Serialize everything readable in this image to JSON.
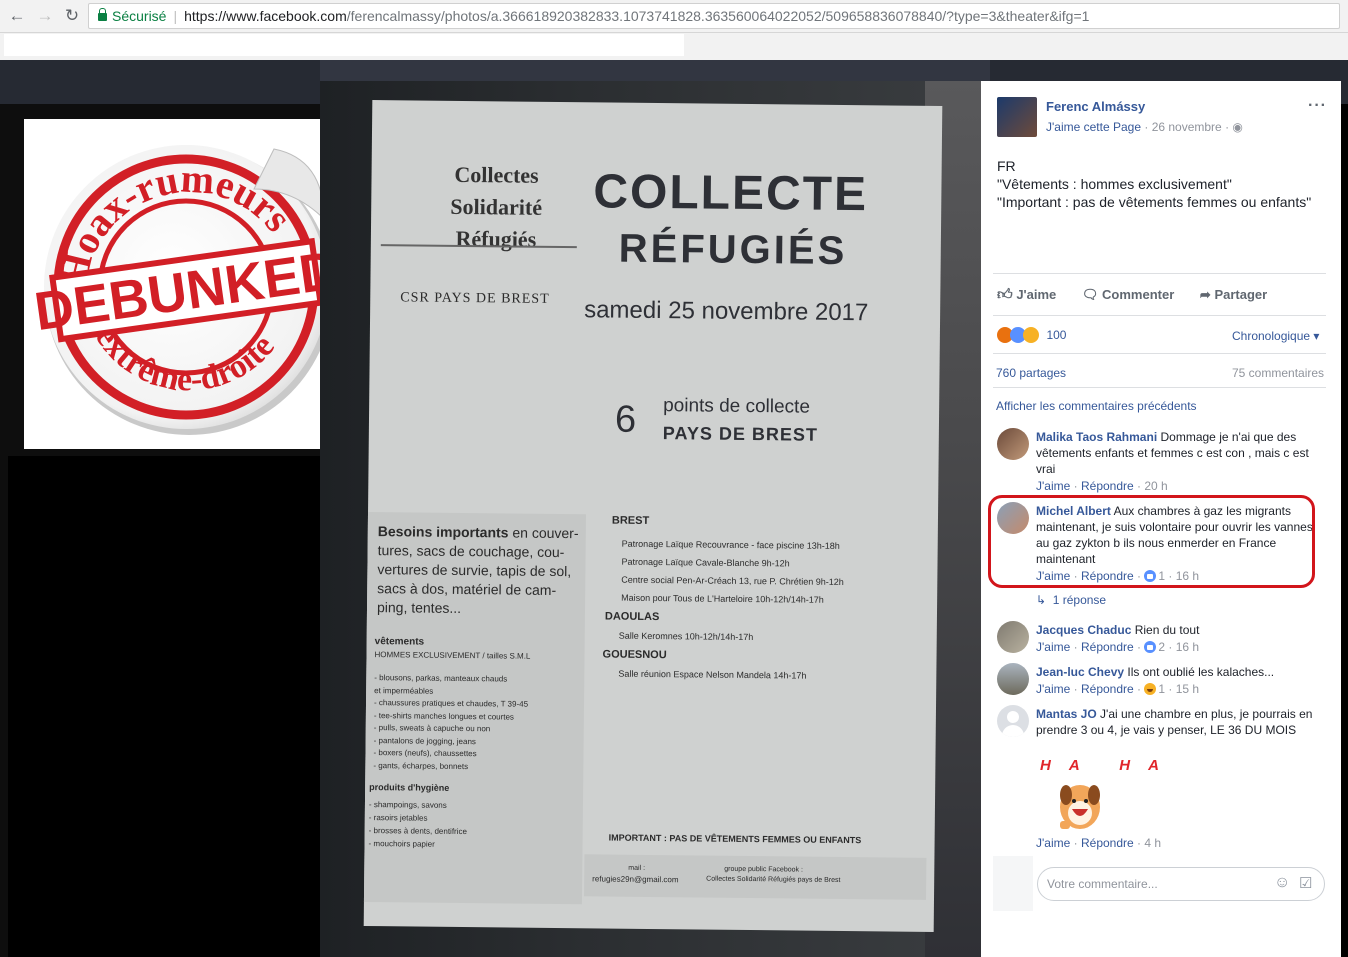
{
  "browser": {
    "secure_label": "Sécurisé",
    "url_host": "https://www.facebook.com",
    "url_path": "/ferencalmassy/photos/a.366618920382833.1073741828.363560064022052/509658836078840/?type=3&theater&ifg=1"
  },
  "stamp": {
    "top_text": "Hoax-rumeurs",
    "center_text": "DEBUNKED",
    "bottom_text": "d'extrême-droite"
  },
  "poster": {
    "org_line1": "Collectes",
    "org_line2": "Solidarité",
    "org_line3": "Réfugiés",
    "org_sub": "CSR PAYS DE BREST",
    "title1": "COLLECTE",
    "title2": "RÉFUGIÉS",
    "date": "samedi 25 novembre 2017",
    "points_number": "6",
    "points_line1": "points de collecte",
    "points_line2": "PAYS DE BREST",
    "needs_bold": "Besoins importants",
    "needs_line1": " en couver-",
    "needs_line2": "tures, sacs de couchage, cou-",
    "needs_line3": "vertures de survie, tapis de sol,",
    "needs_line4": "sacs à dos, matériel de cam-",
    "needs_line5": "ping, tentes...",
    "clothes_title": "vêtements",
    "clothes_sub": "HOMMES EXCLUSIVEMENT / tailles S.M.L",
    "clothes_items": [
      "- blousons, parkas, manteaux chauds",
      "  et imperméables",
      "- chaussures pratiques et chaudes, T 39-45",
      "- tee-shirts manches longues et courtes",
      "- pulls, sweats à capuche ou non",
      "- pantalons de jogging, jeans",
      "- boxers (neufs), chaussettes",
      "- gants, écharpes, bonnets"
    ],
    "hygiene_title": "produits d'hygiène",
    "hygiene_items": [
      "- shampoings, savons",
      "- rasoirs jetables",
      "- brosses à dents, dentifrice",
      "- mouchoirs papier"
    ],
    "brest": "BREST",
    "brest_items": [
      "Patronage Laïque Recouvrance - face piscine 13h-18h",
      "Patronage Laïque Cavale-Blanche  9h-12h",
      "Centre social Pen-Ar-Créach 13, rue P. Chrétien 9h-12h",
      "Maison pour Tous de L'Harteloire 10h-12h/14h-17h"
    ],
    "daoulas": "DAOULAS",
    "daoulas_item": "Salle Keromnes 10h-12h/14h-17h",
    "gouesnou": "GOUESNOU",
    "gouesnou_item": "Salle réunion Espace Nelson Mandela 14h-17h",
    "important": "IMPORTANT : PAS DE VÊTEMENTS FEMMES OU ENFANTS",
    "mail_label": "mail :",
    "mail": "refugies29n@gmail.com",
    "group_label": "groupe public Facebook :",
    "group_name": "Collectes Solidarité Réfugiés pays de Brest"
  },
  "post": {
    "author": "Ferenc Almássy",
    "like_page": "J'aime cette Page",
    "date": "26 novembre",
    "text_lines": [
      "FR",
      "\"Vêtements : hommes exclusivement\"",
      "\"Important : pas de vêtements femmes ou enfants\""
    ],
    "action_like": "J'aime",
    "action_comment": "Commenter",
    "action_share": "Partager",
    "reaction_count": "100",
    "sort_label": "Chronologique",
    "shares": "760 partages",
    "comments_count": "75 commentaires",
    "previous_comments": "Afficher les commentaires précédents"
  },
  "comments": [
    {
      "name": "Malika Taos Rahmani",
      "text": "Dommage je n'ai que des vêtements enfants et femmes c est con , mais c est vrai",
      "like": "J'aime",
      "reply": "Répondre",
      "time": "20 h",
      "reactions": ""
    },
    {
      "name": "Michel Albert",
      "text": "Aux chambres à gaz les migrants maintenant, je suis volontaire pour ouvrir les vannes au gaz zykton b ils nous enmerder en France maintenant",
      "like": "J'aime",
      "reply": "Répondre",
      "time": "16 h",
      "reactions": "1"
    },
    {
      "name": "Jacques Chaduc",
      "text": "Rien du tout",
      "like": "J'aime",
      "reply": "Répondre",
      "time": "16 h",
      "reactions": "2"
    },
    {
      "name": "Jean-luc Chevy",
      "text": "Ils ont oublié les kalaches...",
      "like": "J'aime",
      "reply": "Répondre",
      "time": "15 h",
      "reactions": "1"
    },
    {
      "name": "Mantas JO",
      "text": "J'ai une chambre en plus, je pourrais en prendre 3 ou 4, je vais y penser, LE 36 DU MOIS",
      "like": "J'aime",
      "reply": "Répondre",
      "time": "4 h",
      "reactions": ""
    }
  ],
  "reply_link": "1 réponse",
  "sticker_text": "HA HA",
  "comment_placeholder": "Votre commentaire..."
}
